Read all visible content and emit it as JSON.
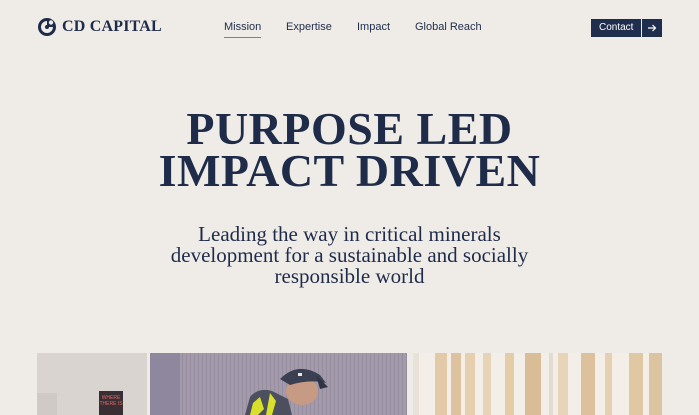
{
  "brand": {
    "name": "CD CAPITAL",
    "logo_icon": "cd-capital-logo-icon"
  },
  "nav": {
    "items": [
      {
        "label": "Mission",
        "active": true
      },
      {
        "label": "Expertise",
        "active": false
      },
      {
        "label": "Impact",
        "active": false
      },
      {
        "label": "Global Reach",
        "active": false
      }
    ]
  },
  "contact": {
    "label": "Contact",
    "icon": "arrow-right-icon"
  },
  "hero": {
    "title_line1": "PURPOSE LED",
    "title_line2": "IMPACT DRIVEN",
    "subtitle_line1": "Leading the way in critical minerals",
    "subtitle_line2": "development for a sustainable and socially",
    "subtitle_line3": "responsible world"
  },
  "photos": {
    "photo1_sign_line1": "WHERE",
    "photo1_sign_line2": "THERE IS"
  },
  "colors": {
    "background": "#efebe7",
    "navy": "#1e2c4a",
    "accent": "#e0584c"
  }
}
